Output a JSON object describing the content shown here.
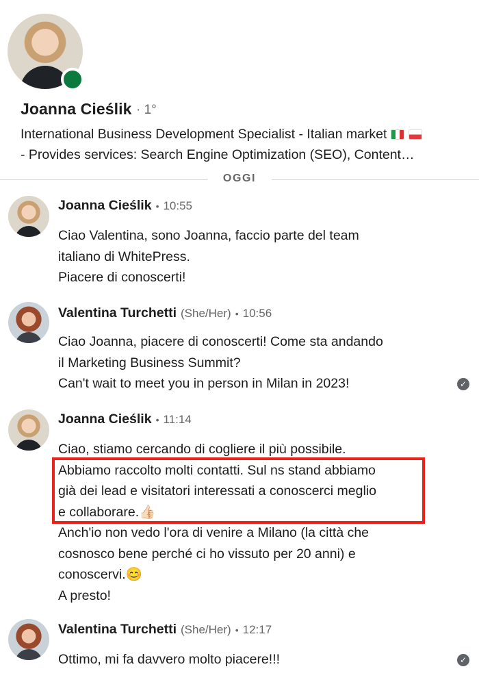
{
  "profile": {
    "name": "Joanna Cieślik",
    "degree": "· 1°",
    "headline_line1": "International Business Development Specialist - Italian market",
    "headline_line2": "- Provides services: Search Engine Optimization (SEO), Content…",
    "status": "online",
    "status_color": "#0a7a3f"
  },
  "day_divider": "OGGI",
  "messages": [
    {
      "sender": "Joanna Cieślik",
      "time": "10:55",
      "lines": [
        "Ciao Valentina, sono Joanna, faccio parte del team",
        "italiano di WhitePress.",
        "Piacere di conoscerti!"
      ]
    },
    {
      "sender": "Valentina Turchetti",
      "pronouns": "(She/Her)",
      "time": "10:56",
      "lines": [
        "Ciao Joanna, piacere di conoscerti! Come sta andando",
        "il Marketing Business Summit?",
        "Can't wait to meet you in person in Milan in 2023!"
      ]
    },
    {
      "sender": "Joanna Cieślik",
      "time": "11:14",
      "lines": [
        "Ciao, stiamo cercando di cogliere il più possibile.",
        "Abbiamo raccolto molti contatti. Sul ns stand abbiamo",
        "già dei lead e visitatori interessati a conoscerci meglio",
        "e collaborare.👍🏻",
        "Anch'io non vedo l'ora di venire a Milano (la città che",
        "cosnosco bene perché ci ho vissuto per 20 anni) e",
        "conoscervi.😊",
        "A presto!"
      ]
    },
    {
      "sender": "Valentina Turchetti",
      "pronouns": "(She/Her)",
      "time": "12:17",
      "lines": [
        "Ottimo, mi fa davvero molto piacere!!!"
      ]
    }
  ],
  "colors": {
    "highlight": "#e8231b",
    "secondary_text": "#666666"
  }
}
